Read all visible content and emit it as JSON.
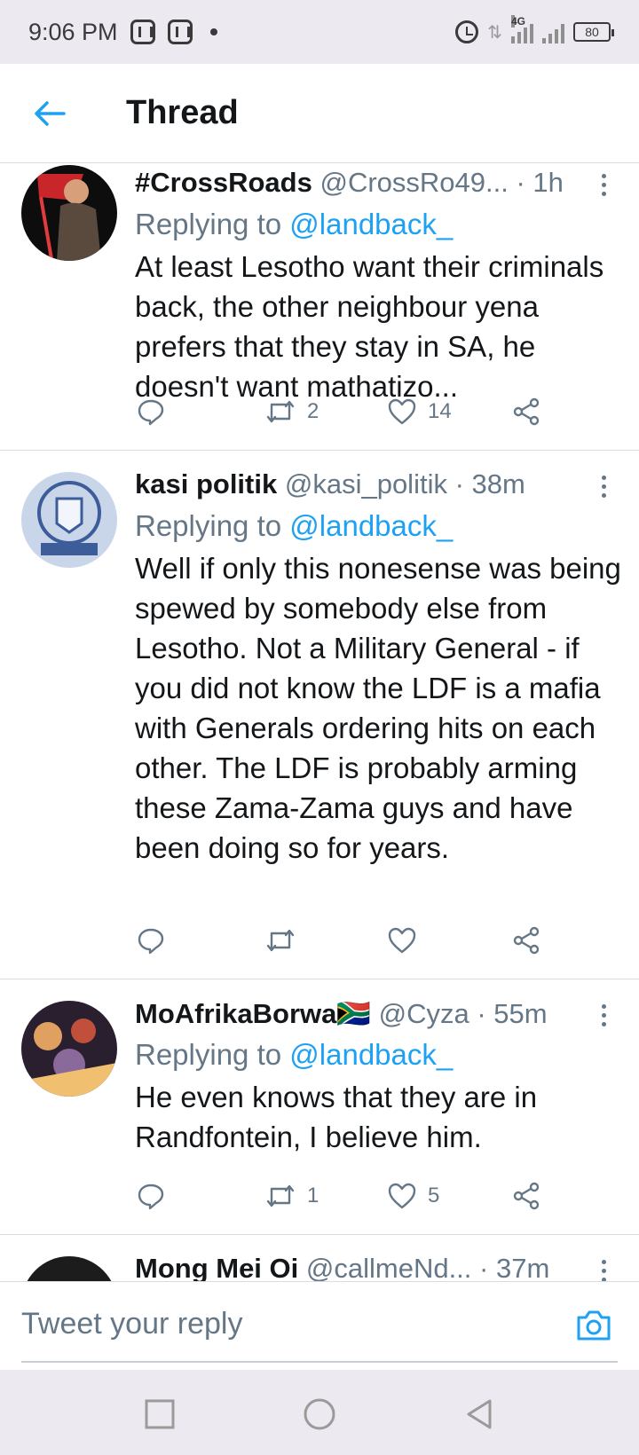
{
  "status_bar": {
    "time": "9:06 PM",
    "network": "4G",
    "battery": "80"
  },
  "header": {
    "title": "Thread"
  },
  "tweets": [
    {
      "name": "#CrossRoads",
      "handle": "@CrossRo49...",
      "time": "· 1h",
      "replying_label": "Replying to",
      "replying_handle": "@landback_",
      "text": "At least Lesotho want their criminals back, the other neighbour yena prefers that they stay in SA, he doesn't want mathatizo...",
      "retweets": "2",
      "likes": "14"
    },
    {
      "name": "kasi politik",
      "handle": "@kasi_politik",
      "time": "· 38m",
      "replying_label": "Replying to",
      "replying_handle": "@landback_",
      "text": "Well if only this nonesense was being spewed by somebody else from Lesotho. Not a Military General - if you did not know the LDF is a mafia with Generals ordering hits on each other. The LDF is probably arming these Zama-Zama guys and have been doing so for years.",
      "retweets": "",
      "likes": ""
    },
    {
      "name": "MoAfrikaBorwa🇿🇦",
      "handle": "@Cyza",
      "time": "· 55m",
      "replying_label": "Replying to",
      "replying_handle": "@landback_",
      "text": "He even knows that they are in Randfontein, I believe him.",
      "retweets": "1",
      "likes": "5"
    },
    {
      "name": "Mong Mei Oi",
      "handle": "@callmeNd...",
      "time": "· 37m"
    }
  ],
  "reply_bar": {
    "placeholder": "Tweet your reply"
  },
  "colors": {
    "accent": "#1da1f2",
    "secondary_text": "#657786",
    "primary_text": "#14171a"
  }
}
